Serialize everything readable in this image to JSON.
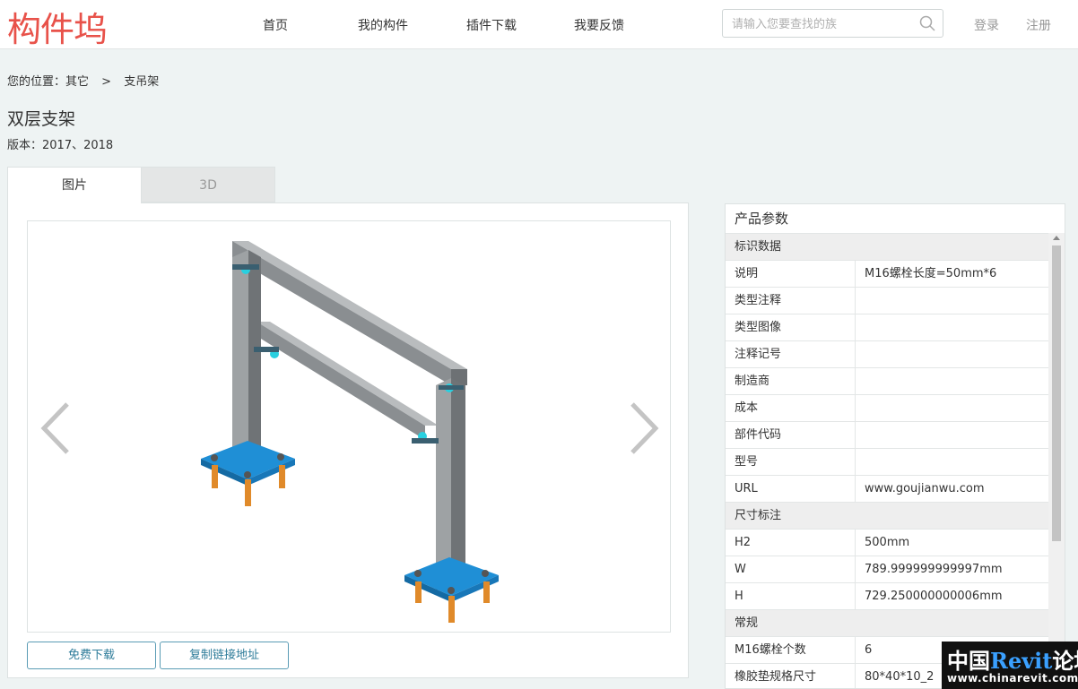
{
  "header": {
    "logo": "构件坞",
    "nav": [
      "首页",
      "我的构件",
      "插件下载",
      "我要反馈"
    ],
    "search_placeholder": "请输入您要查找的族",
    "login": "登录",
    "register": "注册"
  },
  "breadcrumb": {
    "prefix": "您的位置：",
    "items": [
      "其它",
      "支吊架"
    ],
    "separator": ">"
  },
  "product": {
    "title": "双层支架",
    "version": "版本：2017、2018"
  },
  "tabs": [
    "图片",
    "3D"
  ],
  "buttons": {
    "download": "免费下载",
    "copy_link": "复制链接地址"
  },
  "params": {
    "title": "产品参数",
    "groups": [
      {
        "name": "标识数据",
        "rows": [
          {
            "k": "说明",
            "v": "M16螺栓长度=50mm*6"
          },
          {
            "k": "类型注释",
            "v": ""
          },
          {
            "k": "类型图像",
            "v": ""
          },
          {
            "k": "注释记号",
            "v": ""
          },
          {
            "k": "制造商",
            "v": ""
          },
          {
            "k": "成本",
            "v": ""
          },
          {
            "k": "部件代码",
            "v": ""
          },
          {
            "k": "型号",
            "v": ""
          },
          {
            "k": "URL",
            "v": "www.goujianwu.com"
          }
        ]
      },
      {
        "name": "尺寸标注",
        "rows": [
          {
            "k": "H2",
            "v": "500mm"
          },
          {
            "k": "W",
            "v": "789.999999999997mm"
          },
          {
            "k": "H",
            "v": "729.250000000006mm"
          }
        ]
      },
      {
        "name": "常规",
        "rows": [
          {
            "k": "M16螺栓个数",
            "v": "6"
          },
          {
            "k": "橡胶垫规格尺寸",
            "v": "80*40*10_2"
          }
        ]
      }
    ]
  },
  "watermark": {
    "line1_a": "中国",
    "line1_b": "Revit",
    "line1_c": "论坛",
    "line2": "www.chinarevit.com"
  },
  "colors": {
    "logo": "#e8524a",
    "button_border": "#5a9cb5",
    "steel": "#8a8e91",
    "plate": "#1f8fd6",
    "bolt": "#e08a2a"
  }
}
